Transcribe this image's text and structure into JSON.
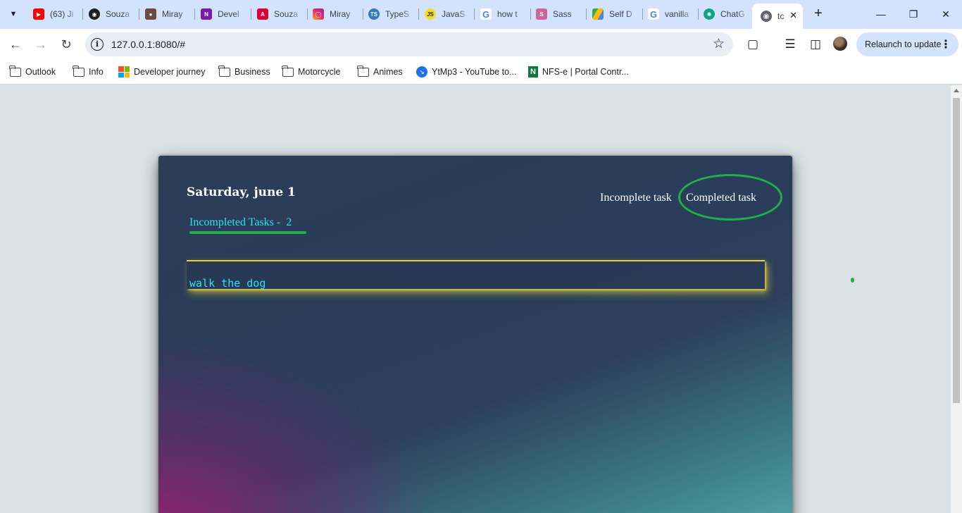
{
  "browser": {
    "tabs": [
      {
        "title": "(63) Ji",
        "icon": "youtube-icon",
        "color": "#ff0000"
      },
      {
        "title": "Souza",
        "icon": "github-icon",
        "color": "#1f1f1f"
      },
      {
        "title": "Miray",
        "icon": "person-icon",
        "color": "#6b4b3e"
      },
      {
        "title": "Devel",
        "icon": "onenote-icon",
        "color": "#7719aa"
      },
      {
        "title": "Souza",
        "icon": "angular-icon",
        "color": "#dd0031"
      },
      {
        "title": "Miray",
        "icon": "instagram-icon",
        "color": "#e1306c"
      },
      {
        "title": "TypeS",
        "icon": "typescript-icon",
        "color": "#3178c6"
      },
      {
        "title": "JavaS",
        "icon": "javascript-icon",
        "color": "#f7df1e"
      },
      {
        "title": "how t",
        "icon": "google-icon",
        "color": "#4285f4"
      },
      {
        "title": "Sass",
        "icon": "sass-icon",
        "color": "#cc6699"
      },
      {
        "title": "Self D",
        "icon": "google-drive-icon",
        "color": "#34a853"
      },
      {
        "title": "vanilla",
        "icon": "google-icon",
        "color": "#4285f4"
      },
      {
        "title": "ChatG",
        "icon": "chatgpt-icon",
        "color": "#10a37f"
      }
    ],
    "active_tab": {
      "title": "tc",
      "icon": "globe-icon"
    },
    "url": "127.0.0.1:8080/#",
    "relaunch_label": "Relaunch to update",
    "bookmarks": [
      {
        "label": "Outlook",
        "icon": "folder-icon"
      },
      {
        "label": "Info",
        "icon": "folder-icon"
      },
      {
        "label": "Developer journey",
        "icon": "microsoft-icon"
      },
      {
        "label": "Business",
        "icon": "folder-icon"
      },
      {
        "label": "Motorcycle",
        "icon": "folder-icon"
      },
      {
        "label": "Animes",
        "icon": "folder-icon"
      },
      {
        "label": "YtMp3 - YouTube to...",
        "icon": "ytmp3-icon"
      },
      {
        "label": "NFS-e | Portal Contr...",
        "icon": "nfse-icon"
      }
    ]
  },
  "app": {
    "date": "Saturday, june 1",
    "tabs": {
      "incomplete_label": "Incomplete task",
      "completed_label": "Completed task"
    },
    "counter": {
      "label": "Incompleted Tasks -",
      "count": "2"
    },
    "tasks": [
      {
        "text": "walk the dog"
      }
    ],
    "colors": {
      "accent_cyan": "#2ce1f5",
      "accent_green": "#1fb04a",
      "task_border_yellow": "#ead33d"
    }
  }
}
